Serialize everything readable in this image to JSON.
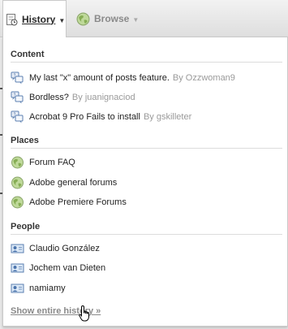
{
  "nav": {
    "history_label": "History",
    "browse_label": "Browse"
  },
  "sections": {
    "content": {
      "title": "Content",
      "items": [
        {
          "title": "My last \"x\" amount of posts feature.",
          "author": "By Ozzwoman9",
          "icon": "discussion-icon"
        },
        {
          "title": "Bordless?",
          "author": "By juanignaciod",
          "icon": "discussion-icon"
        },
        {
          "title": "Acrobat 9 Pro Fails to install",
          "author": "By gskilleter",
          "icon": "discussion-icon"
        }
      ]
    },
    "places": {
      "title": "Places",
      "items": [
        {
          "title": "Forum FAQ",
          "icon": "globe-icon"
        },
        {
          "title": "Adobe general forums",
          "icon": "globe-icon"
        },
        {
          "title": "Adobe Premiere Forums",
          "icon": "globe-icon"
        }
      ]
    },
    "people": {
      "title": "People",
      "items": [
        {
          "title": "Claudio González",
          "icon": "profile-card-icon"
        },
        {
          "title": "Jochem van Dieten",
          "icon": "profile-card-icon"
        },
        {
          "title": "namiamy",
          "icon": "profile-card-icon"
        }
      ]
    }
  },
  "footer": {
    "show_history_label": "Show entire history »"
  }
}
